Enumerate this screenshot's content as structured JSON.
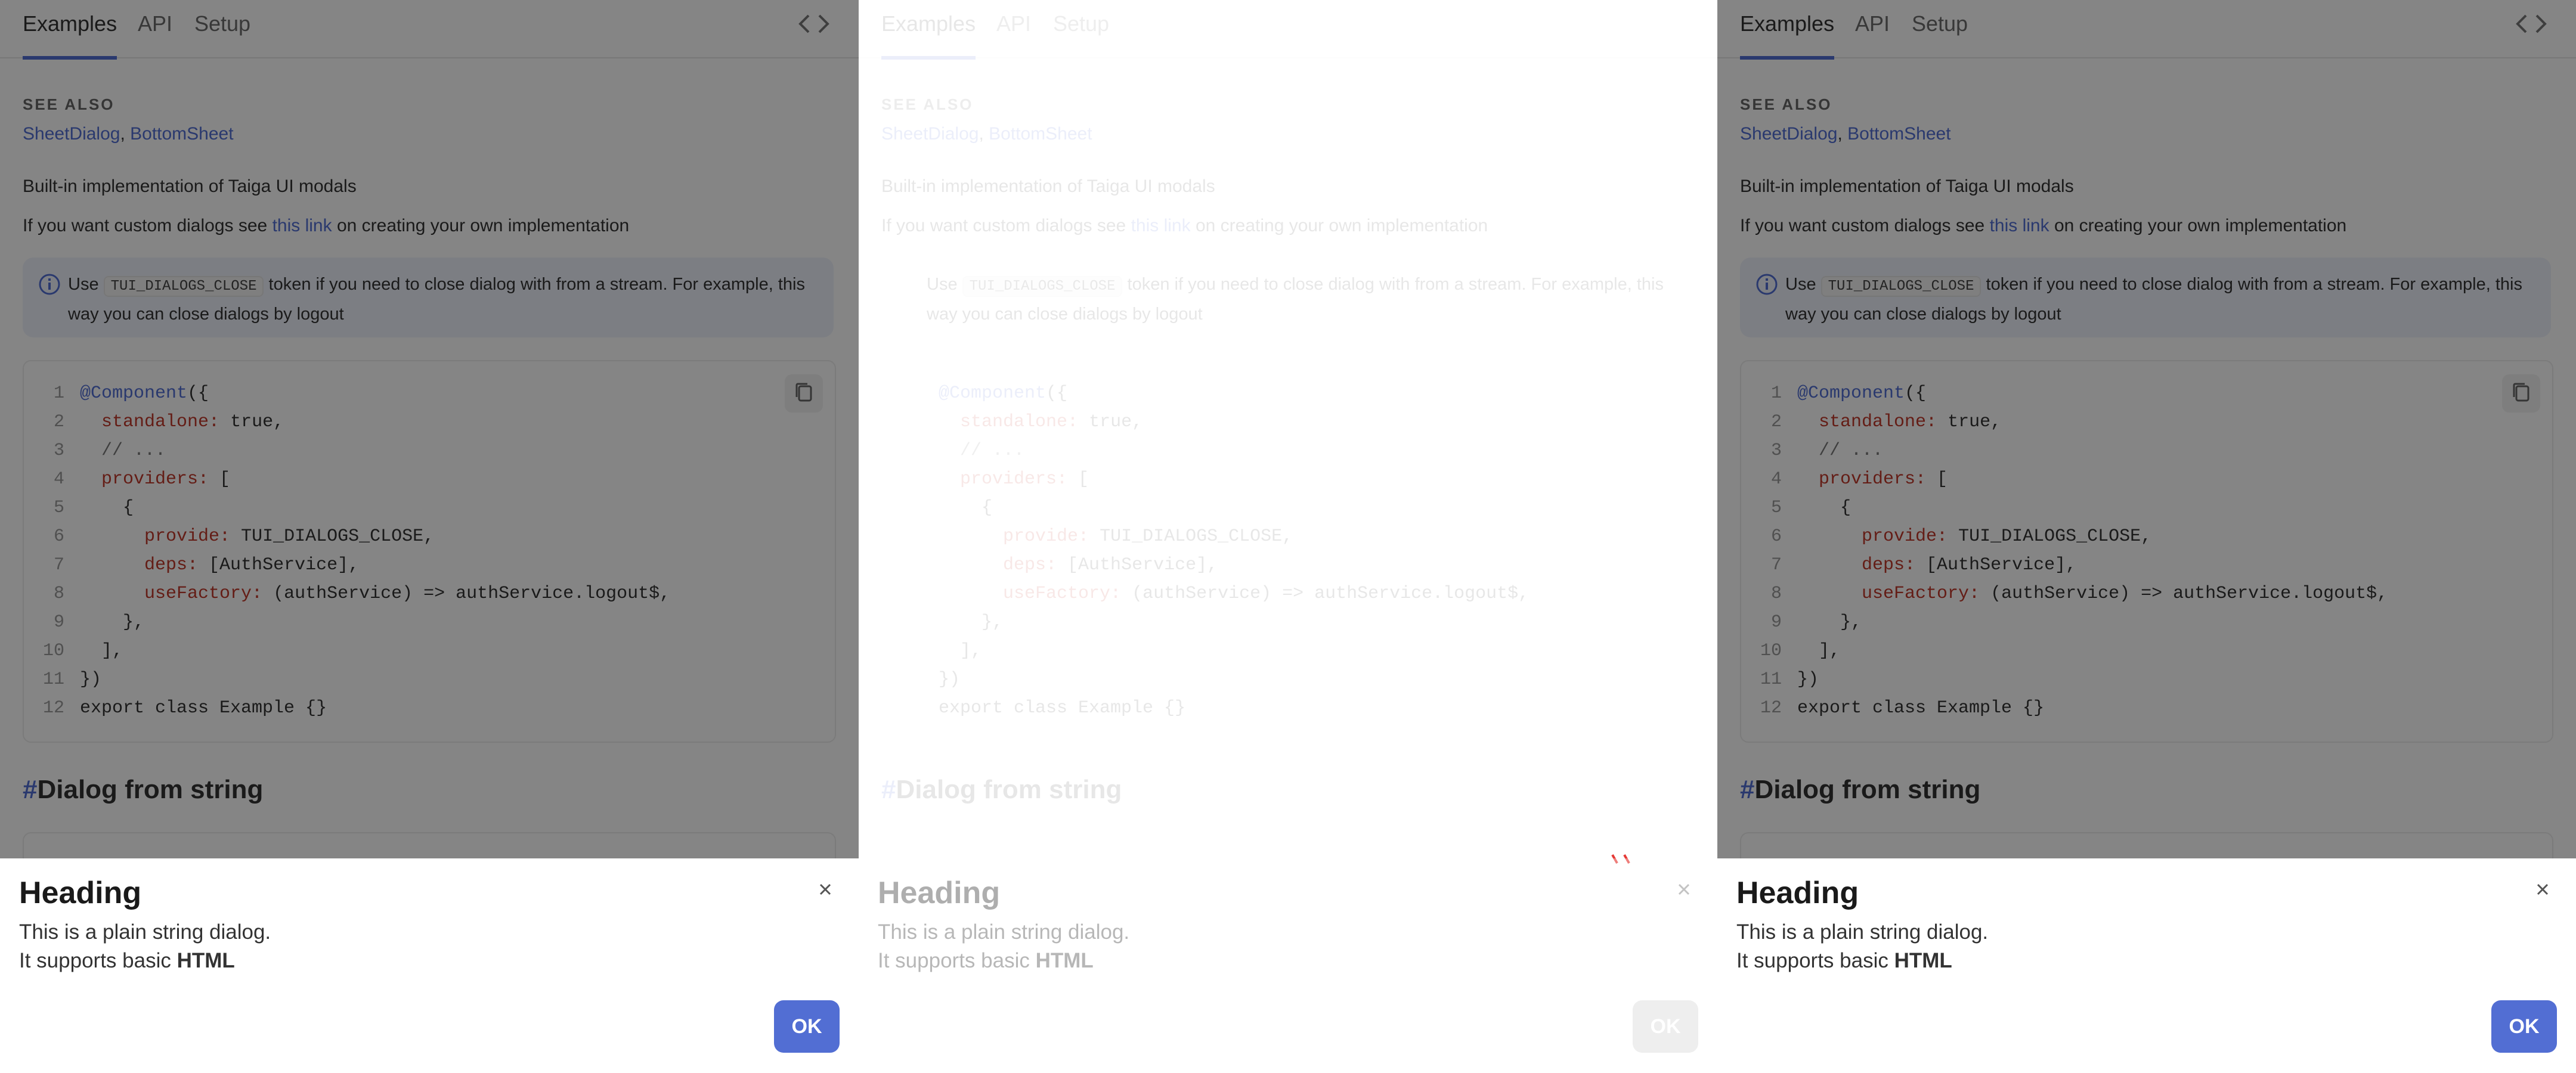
{
  "tabs": {
    "examples": "Examples",
    "api": "API",
    "setup": "Setup"
  },
  "see_also": {
    "title": "SEE ALSO",
    "link1": "SheetDialog",
    "separator": ", ",
    "link2": "BottomSheet"
  },
  "description": {
    "line1": "Built-in implementation of Taiga UI modals",
    "line2_prefix": "If you want custom dialogs see ",
    "line2_link": "this link",
    "line2_suffix": " on creating your own implementation"
  },
  "notice": {
    "prefix": "Use ",
    "token": "TUI_DIALOGS_CLOSE",
    "suffix": " token if you need to close dialog with from a stream. For example, this way you can close dialogs by logout"
  },
  "code": {
    "line_numbers": [
      "1",
      "2",
      "3",
      "4",
      "5",
      "6",
      "7",
      "8",
      "9",
      "10",
      "11",
      "12"
    ],
    "l1_dec": "@Component",
    "l1_rest": "({",
    "l2_key": "standalone:",
    "l2_rest": " true,",
    "l3_comment": "// ...",
    "l4_key": "providers:",
    "l4_rest": " [",
    "l5": "{",
    "l6_key": "provide:",
    "l6_rest": " TUI_DIALOGS_CLOSE,",
    "l7_key": "deps:",
    "l7_rest": " [AuthService],",
    "l8_key": "useFactory:",
    "l8_rest": " (authService) => authService.logout$,",
    "l9": "},",
    "l10": "],",
    "l11": "})",
    "l12": "export class Example {}"
  },
  "section": {
    "hash": "#",
    "title": "Dialog from string"
  },
  "dialog": {
    "heading": "Heading",
    "line1": "This is a plain string dialog.",
    "line2_prefix": "It supports basic ",
    "line2_bold": "HTML",
    "ok": "OK",
    "close_glyph": "✕"
  },
  "colors": {
    "accent": "#526ed3",
    "backdrop": "#5b5b5b",
    "keyword": "#c0392b",
    "notice_bg": "#eef2fb"
  },
  "icons": [
    "code-toggle-icon",
    "info-icon",
    "copy-icon",
    "close-icon"
  ]
}
